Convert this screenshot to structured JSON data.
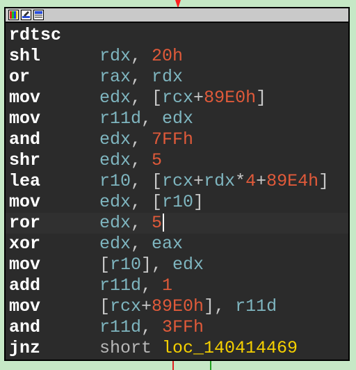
{
  "colors": {
    "background": "#c6e8c6",
    "node_background": "#2b2b2b",
    "mnemonic": "#ffffff",
    "register": "#7fb6c0",
    "number": "#e05a3a",
    "punctuation": "#c8c8c8",
    "keyword": "#b8b8b8",
    "label": "#f5d000",
    "edge_incoming": "#ff2020",
    "edge_false": "#e02020",
    "edge_true": "#20a020"
  },
  "titlebar": {
    "icons": [
      "color-palette-icon",
      "rename-node-icon",
      "graph-overview-icon"
    ]
  },
  "instructions": [
    {
      "mnemonic": "rdtsc",
      "tokens": []
    },
    {
      "mnemonic": "shl",
      "tokens": [
        {
          "t": "op",
          "v": "rdx"
        },
        {
          "t": "pun",
          "v": ", "
        },
        {
          "t": "num",
          "v": "20h"
        }
      ]
    },
    {
      "mnemonic": "or",
      "tokens": [
        {
          "t": "op",
          "v": "rax"
        },
        {
          "t": "pun",
          "v": ", "
        },
        {
          "t": "op",
          "v": "rdx"
        }
      ]
    },
    {
      "mnemonic": "mov",
      "tokens": [
        {
          "t": "op",
          "v": "edx"
        },
        {
          "t": "pun",
          "v": ", ["
        },
        {
          "t": "op",
          "v": "rcx"
        },
        {
          "t": "pun",
          "v": "+"
        },
        {
          "t": "num",
          "v": "89E0h"
        },
        {
          "t": "pun",
          "v": "]"
        }
      ]
    },
    {
      "mnemonic": "mov",
      "tokens": [
        {
          "t": "op",
          "v": "r11d"
        },
        {
          "t": "pun",
          "v": ", "
        },
        {
          "t": "op",
          "v": "edx"
        }
      ]
    },
    {
      "mnemonic": "and",
      "tokens": [
        {
          "t": "op",
          "v": "edx"
        },
        {
          "t": "pun",
          "v": ", "
        },
        {
          "t": "num",
          "v": "7FFh"
        }
      ]
    },
    {
      "mnemonic": "shr",
      "tokens": [
        {
          "t": "op",
          "v": "edx"
        },
        {
          "t": "pun",
          "v": ", "
        },
        {
          "t": "num",
          "v": "5"
        }
      ]
    },
    {
      "mnemonic": "lea",
      "tokens": [
        {
          "t": "op",
          "v": "r10"
        },
        {
          "t": "pun",
          "v": ", ["
        },
        {
          "t": "op",
          "v": "rcx"
        },
        {
          "t": "pun",
          "v": "+"
        },
        {
          "t": "op",
          "v": "rdx"
        },
        {
          "t": "pun",
          "v": "*"
        },
        {
          "t": "num",
          "v": "4"
        },
        {
          "t": "pun",
          "v": "+"
        },
        {
          "t": "num",
          "v": "89E4h"
        },
        {
          "t": "pun",
          "v": "]"
        }
      ]
    },
    {
      "mnemonic": "mov",
      "tokens": [
        {
          "t": "op",
          "v": "edx"
        },
        {
          "t": "pun",
          "v": ", ["
        },
        {
          "t": "op",
          "v": "r10"
        },
        {
          "t": "pun",
          "v": "]"
        }
      ]
    },
    {
      "mnemonic": "ror",
      "current": true,
      "tokens": [
        {
          "t": "op",
          "v": "edx"
        },
        {
          "t": "pun",
          "v": ", "
        },
        {
          "t": "num",
          "v": "5"
        }
      ]
    },
    {
      "mnemonic": "xor",
      "tokens": [
        {
          "t": "op",
          "v": "edx"
        },
        {
          "t": "pun",
          "v": ", "
        },
        {
          "t": "op",
          "v": "eax"
        }
      ]
    },
    {
      "mnemonic": "mov",
      "tokens": [
        {
          "t": "pun",
          "v": "["
        },
        {
          "t": "op",
          "v": "r10"
        },
        {
          "t": "pun",
          "v": "], "
        },
        {
          "t": "op",
          "v": "edx"
        }
      ]
    },
    {
      "mnemonic": "add",
      "tokens": [
        {
          "t": "op",
          "v": "r11d"
        },
        {
          "t": "pun",
          "v": ", "
        },
        {
          "t": "num",
          "v": "1"
        }
      ]
    },
    {
      "mnemonic": "mov",
      "tokens": [
        {
          "t": "pun",
          "v": "["
        },
        {
          "t": "op",
          "v": "rcx"
        },
        {
          "t": "pun",
          "v": "+"
        },
        {
          "t": "num",
          "v": "89E0h"
        },
        {
          "t": "pun",
          "v": "], "
        },
        {
          "t": "op",
          "v": "r11d"
        }
      ]
    },
    {
      "mnemonic": "and",
      "tokens": [
        {
          "t": "op",
          "v": "r11d"
        },
        {
          "t": "pun",
          "v": ", "
        },
        {
          "t": "num",
          "v": "3FFh"
        }
      ]
    },
    {
      "mnemonic": "jnz",
      "tokens": [
        {
          "t": "kw",
          "v": "short"
        },
        {
          "t": "pun",
          "v": " "
        },
        {
          "t": "loc",
          "v": "loc_140414469"
        }
      ]
    }
  ]
}
